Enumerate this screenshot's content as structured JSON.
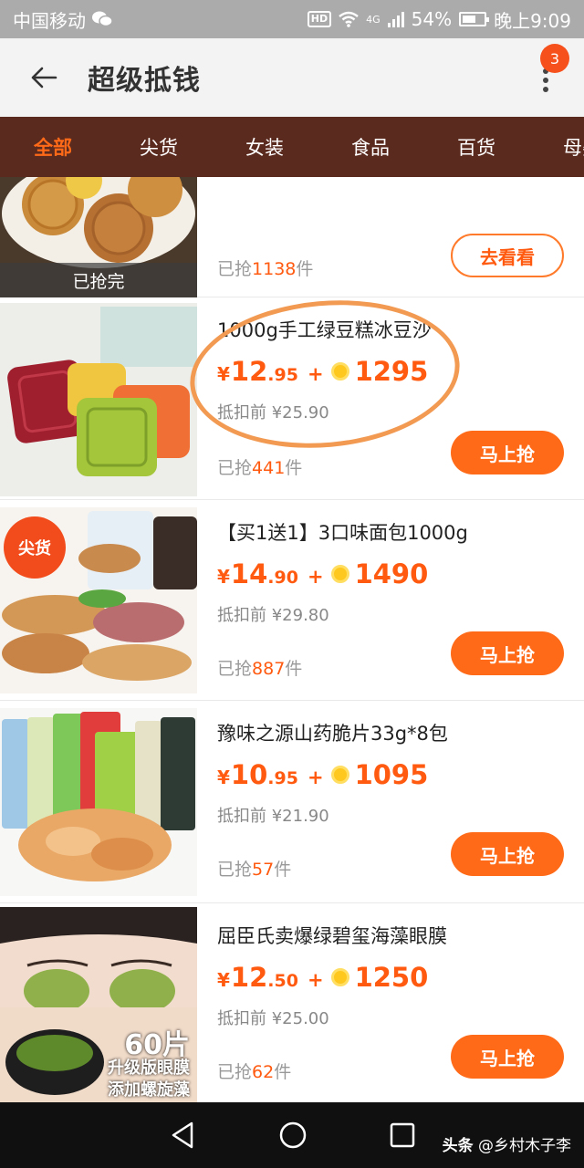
{
  "status_bar": {
    "carrier": "中国移动",
    "network": "4G",
    "battery": "54%",
    "time": "晚上9:09",
    "hd_label": "HD"
  },
  "header": {
    "title": "超级抵钱",
    "badge_count": "3"
  },
  "tabs": [
    {
      "label": "全部",
      "active": true
    },
    {
      "label": "尖货",
      "active": false
    },
    {
      "label": "女装",
      "active": false
    },
    {
      "label": "食品",
      "active": false
    },
    {
      "label": "百货",
      "active": false
    },
    {
      "label": "母婴",
      "active": false
    }
  ],
  "items": [
    {
      "sold_prefix": "已抢",
      "sold_count": "1138",
      "sold_suffix": "件",
      "button": "去看看",
      "overlay": "已抢完"
    },
    {
      "name": "1000g手工绿豆糕冰豆沙",
      "price_yen": "¥",
      "price_int": "12",
      "price_dec": ".95",
      "plus": "+",
      "coins": "1295",
      "orig": "抵扣前 ¥25.90",
      "sold_prefix": "已抢",
      "sold_count": "441",
      "sold_suffix": "件",
      "button": "马上抢"
    },
    {
      "name": "【买1送1】3口味面包1000g",
      "price_yen": "¥",
      "price_int": "14",
      "price_dec": ".90",
      "plus": "+",
      "coins": "1490",
      "orig": "抵扣前 ¥29.80",
      "sold_prefix": "已抢",
      "sold_count": "887",
      "sold_suffix": "件",
      "button": "马上抢",
      "tag": "尖货"
    },
    {
      "name": "豫味之源山药脆片33g*8包",
      "price_yen": "¥",
      "price_int": "10",
      "price_dec": ".95",
      "plus": "+",
      "coins": "1095",
      "orig": "抵扣前 ¥21.90",
      "sold_prefix": "已抢",
      "sold_count": "57",
      "sold_suffix": "件",
      "button": "马上抢"
    },
    {
      "name": "屈臣氏卖爆绿碧玺海藻眼膜",
      "price_yen": "¥",
      "price_int": "12",
      "price_dec": ".50",
      "plus": "+",
      "coins": "1250",
      "orig": "抵扣前 ¥25.00",
      "sold_prefix": "已抢",
      "sold_count": "62",
      "sold_suffix": "件",
      "button": "马上抢",
      "promo_line1": "60片",
      "promo_line2": "升级版眼膜",
      "promo_line3": "添加螺旋藻"
    }
  ],
  "watermark": {
    "brand": "头条",
    "author": "@乡村木子李"
  },
  "colors": {
    "accent": "#ff6a18",
    "tab_bar": "#5b2a1f",
    "price": "#ff5a0f"
  }
}
